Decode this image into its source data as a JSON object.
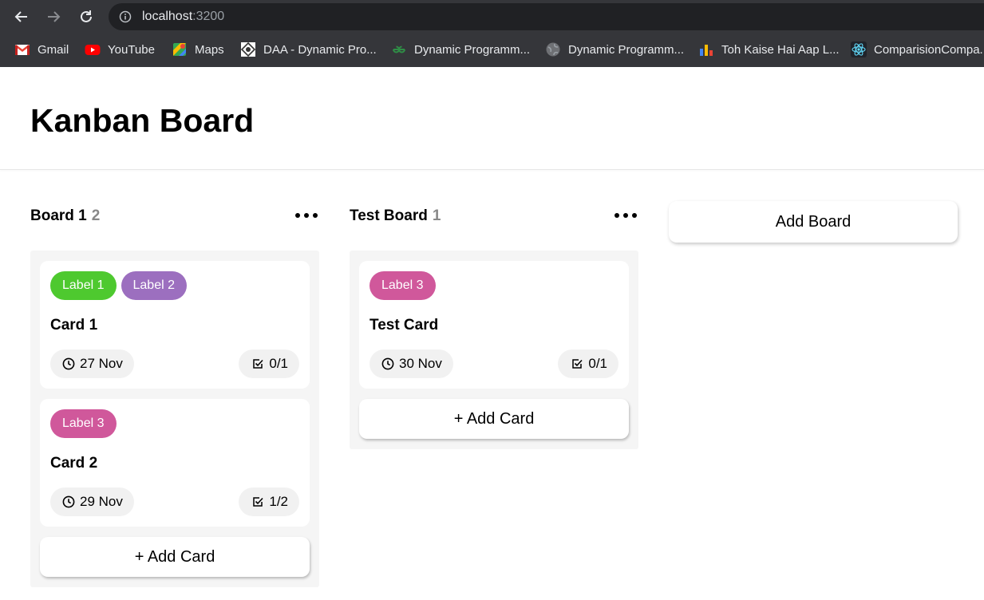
{
  "browser": {
    "url_host": "localhost",
    "url_port": ":3200",
    "bookmarks": [
      {
        "label": "Gmail",
        "icon": "gmail-icon"
      },
      {
        "label": "YouTube",
        "icon": "youtube-icon"
      },
      {
        "label": "Maps",
        "icon": "maps-icon"
      },
      {
        "label": "DAA - Dynamic Pro...",
        "icon": "daa-icon"
      },
      {
        "label": "Dynamic Programm...",
        "icon": "geeksforgeeks-icon"
      },
      {
        "label": "Dynamic Programm...",
        "icon": "globe-icon"
      },
      {
        "label": "Toh Kaise Hai Aap L...",
        "icon": "bar-chart-icon"
      },
      {
        "label": "ComparisionCompa...",
        "icon": "react-icon"
      }
    ]
  },
  "app": {
    "title": "Kanban Board",
    "add_board_label": "Add Board"
  },
  "boards": [
    {
      "title": "Board 1",
      "count": "2",
      "add_card_label": "+ Add Card",
      "cards": [
        {
          "title": "Card 1",
          "labels": [
            {
              "text": "Label 1",
              "color": "#4ec92f"
            },
            {
              "text": "Label 2",
              "color": "#9c6fbf"
            }
          ],
          "date": "27 Nov",
          "tasks": "0/1"
        },
        {
          "title": "Card 2",
          "labels": [
            {
              "text": "Label 3",
              "color": "#d0589b"
            }
          ],
          "date": "29 Nov",
          "tasks": "1/2"
        }
      ]
    },
    {
      "title": "Test Board",
      "count": "1",
      "add_card_label": "+ Add Card",
      "cards": [
        {
          "title": "Test Card",
          "labels": [
            {
              "text": "Label 3",
              "color": "#d0589b"
            }
          ],
          "date": "30 Nov",
          "tasks": "0/1"
        }
      ]
    }
  ]
}
